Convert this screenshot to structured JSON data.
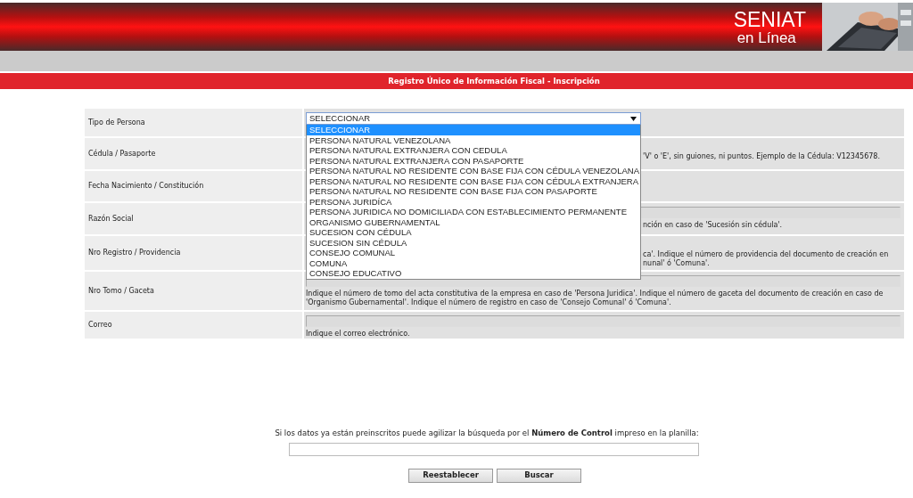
{
  "header": {
    "logo": {
      "title": "SENIAT",
      "subtitle": "en Línea"
    }
  },
  "title_bar": "Registro Único de Información Fiscal - Inscripción",
  "form": {
    "rows": [
      {
        "label": "Tipo de Persona",
        "field": false
      },
      {
        "label": "Cédula / Pasaporte",
        "field": false,
        "hint": "'V' o 'E', sin guiones, ni puntos. Ejemplo de la Cédula: V12345678."
      },
      {
        "label": "Fecha Nacimiento / Constitución",
        "field": false
      },
      {
        "label": "Razón Social",
        "field": true,
        "hint": "nción en caso de 'Sucesión sin cédula'."
      },
      {
        "label": "Nro Registro / Providencia",
        "field": false,
        "hint": "ca'. Indique el número de providencia del documento de creación en nunal' ó 'Comuna'."
      },
      {
        "label": "Nro Tomo / Gaceta",
        "field": true,
        "hint": "Indique el número de tomo del acta constitutiva de la empresa en caso de 'Persona Juridica'. Indique el número de gaceta del documento de creación en caso de 'Organismo Gubernamental'. Indique el número de registro en caso de 'Consejo Comunal' ó 'Comuna'."
      },
      {
        "label": "Correo",
        "field": true,
        "hint": "Indique el correo electrónico."
      }
    ],
    "dropdown": {
      "value": "SELECCIONAR",
      "expanded": true,
      "options": [
        {
          "label": "SELECCIONAR",
          "selected": true
        },
        {
          "label": "PERSONA NATURAL VENEZOLANA",
          "selected": false
        },
        {
          "label": "PERSONA NATURAL EXTRANJERA CON CEDULA",
          "selected": false
        },
        {
          "label": "PERSONA NATURAL EXTRANJERA CON PASAPORTE",
          "selected": false
        },
        {
          "label": "PERSONA NATURAL NO RESIDENTE CON BASE FIJA CON CÉDULA VENEZOLANA",
          "selected": false
        },
        {
          "label": "PERSONA NATURAL NO RESIDENTE CON BASE FIJA CON CÉDULA EXTRANJERA",
          "selected": false
        },
        {
          "label": "PERSONA NATURAL NO RESIDENTE CON BASE FIJA CON PASAPORTE",
          "selected": false
        },
        {
          "label": "PERSONA JURIDÍCA",
          "selected": false
        },
        {
          "label": "PERSONA JURIDICA NO DOMICILIADA CON ESTABLECIMIENTO PERMANENTE",
          "selected": false
        },
        {
          "label": "ORGANISMO GUBERNAMENTAL",
          "selected": false
        },
        {
          "label": "SUCESION CON CÉDULA",
          "selected": false
        },
        {
          "label": "SUCESION SIN CÉDULA",
          "selected": false
        },
        {
          "label": "CONSEJO COMUNAL",
          "selected": false
        },
        {
          "label": "COMUNA",
          "selected": false
        },
        {
          "label": "CONSEJO EDUCATIVO",
          "selected": false
        }
      ]
    }
  },
  "control_search": {
    "prompt": "Si los datos ya están preinscritos puede agilizar la búsqueda por el **Número de Control** impreso en la planilla:"
  },
  "buttons": [
    "Reestablecer",
    "Buscar"
  ]
}
